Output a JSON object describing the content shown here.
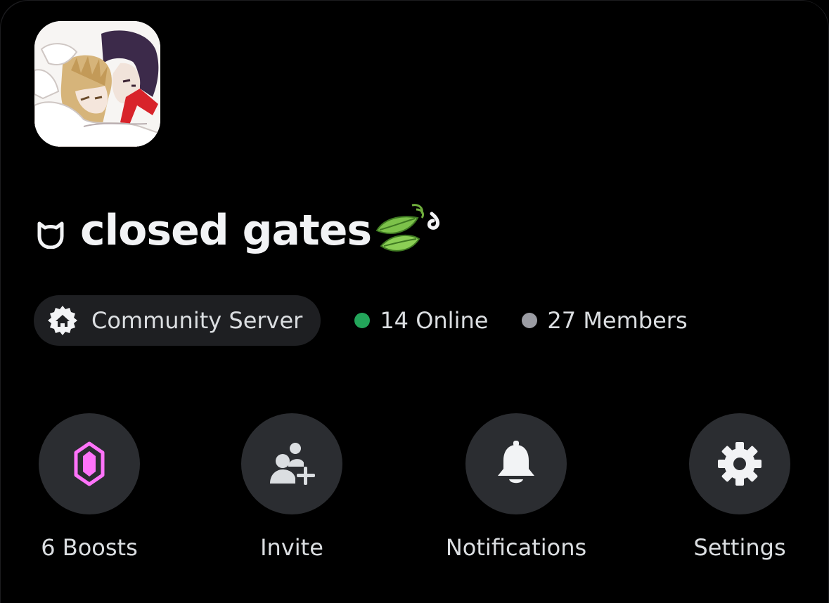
{
  "server": {
    "name": "closed gates",
    "name_symbol_icon": "cat-head-outline-icon",
    "name_decoration_icon": "leaf-emoji-icon",
    "avatar_icon": "anime-art-avatar"
  },
  "badges": {
    "community": {
      "label": "Community Server",
      "icon": "community-home-badge-icon"
    },
    "online": {
      "label": "14 Online",
      "color": "#23a55a"
    },
    "members": {
      "label": "27 Members",
      "color": "#9b9ca3"
    }
  },
  "actions": [
    {
      "label": "6 Boosts",
      "icon": "boost-gem-icon",
      "icon_color": "#ff73fa"
    },
    {
      "label": "Invite",
      "icon": "invite-people-icon"
    },
    {
      "label": "Notifications",
      "icon": "bell-icon"
    },
    {
      "label": "Settings",
      "icon": "gear-icon"
    }
  ],
  "colors": {
    "background": "#000000",
    "surface": "#2b2d31",
    "pill": "#1e1f22",
    "text": "#f2f3f5",
    "muted_text": "#dbdee1"
  }
}
